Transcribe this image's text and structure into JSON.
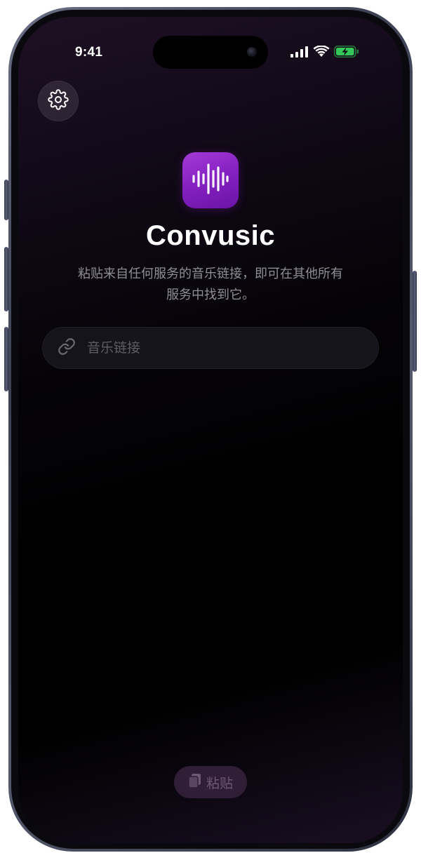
{
  "status_bar": {
    "time": "9:41",
    "signal_icon": "cellular-signal-icon",
    "wifi_icon": "wifi-icon",
    "battery_icon": "battery-charging-icon",
    "battery_color": "#34c759"
  },
  "header": {
    "settings_icon": "gear-icon"
  },
  "app": {
    "icon": "sound-wave-icon",
    "name": "Convusic",
    "description": "粘贴来自任何服务的音乐链接，即可在其他所有服务中找到它。",
    "accent_color": "#9a2fd0"
  },
  "link_input": {
    "icon": "link-icon",
    "placeholder": "音乐链接",
    "value": ""
  },
  "paste_button": {
    "icon": "clipboard-icon",
    "label": "粘贴"
  }
}
